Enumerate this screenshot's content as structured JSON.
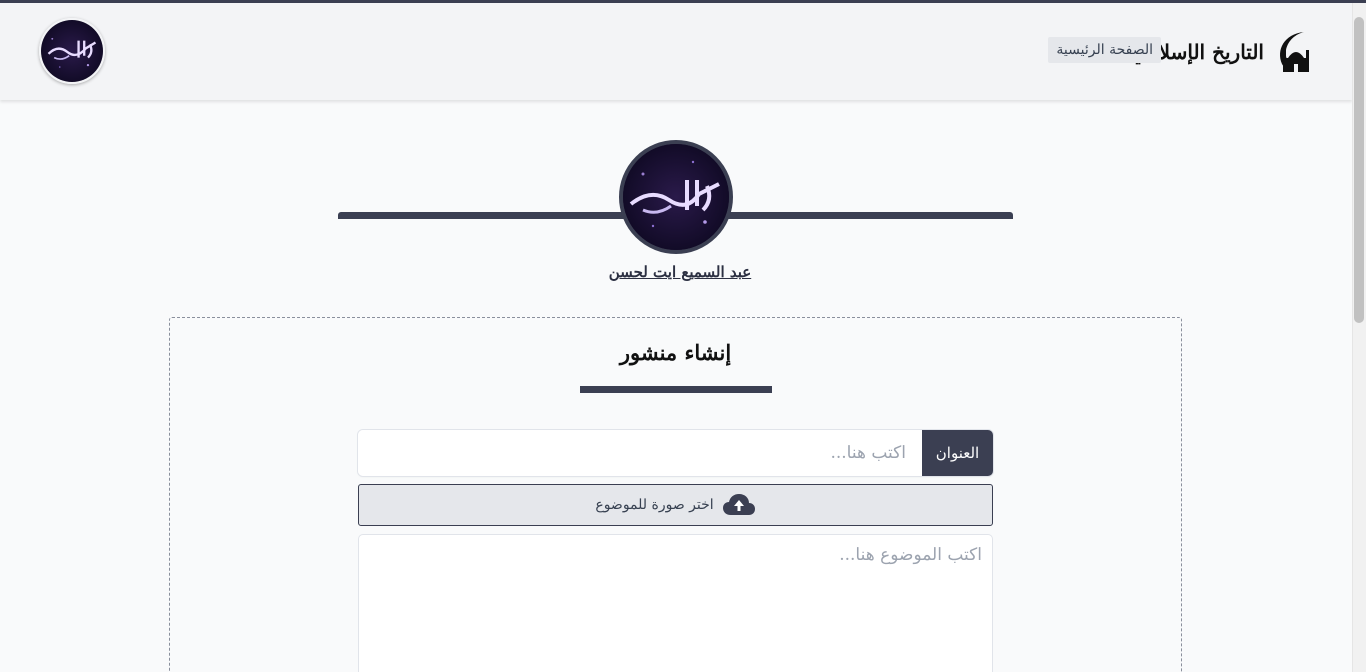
{
  "navbar": {
    "brand_text": "التاريخ الإسلامي",
    "home_label": "الصفحة الرئيسية"
  },
  "profile": {
    "name": "عبد السميع ايت لحسن"
  },
  "post_form": {
    "heading": "إنشاء منشور",
    "title_label": "العنوان",
    "title_placeholder": "اكتب هنا...",
    "title_value": "",
    "upload_label": "اختر صورة للموضوع",
    "body_placeholder": "اكتب الموضوع هنا...",
    "body_value": ""
  },
  "icons": {
    "brand": "mosque-crescent-icon",
    "upload": "cloud-upload-icon"
  },
  "colors": {
    "accent": "#3b3f52",
    "navbar_bg": "#f3f4f6",
    "page_bg": "#f9fafb"
  }
}
